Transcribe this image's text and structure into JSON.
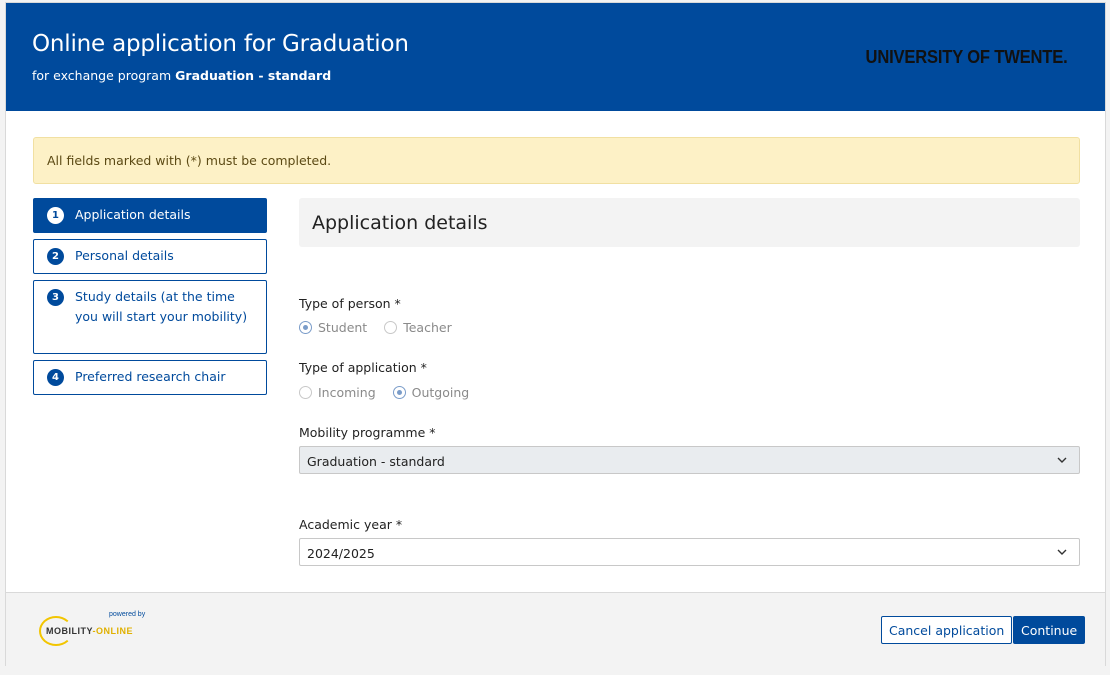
{
  "header": {
    "title": "Online application for Graduation",
    "subtitle_prefix": "for exchange program",
    "subtitle_program": "Graduation - standard",
    "brand": "UNIVERSITY OF TWENTE."
  },
  "notice": "All fields marked with (*) must be completed.",
  "steps": [
    {
      "num": "1",
      "label": "Application details",
      "active": true
    },
    {
      "num": "2",
      "label": "Personal details",
      "active": false
    },
    {
      "num": "3",
      "label": "Study details (at the time you will start your mobility)",
      "active": false
    },
    {
      "num": "4",
      "label": "Preferred research chair",
      "active": false
    }
  ],
  "panel": {
    "heading": "Application details",
    "type_of_person": {
      "label": "Type of person *",
      "options": [
        {
          "label": "Student",
          "checked": true
        },
        {
          "label": "Teacher",
          "checked": false
        }
      ]
    },
    "type_of_application": {
      "label": "Type of application *",
      "options": [
        {
          "label": "Incoming",
          "checked": false
        },
        {
          "label": "Outgoing",
          "checked": true
        }
      ]
    },
    "mobility_programme": {
      "label": "Mobility programme *",
      "value": "Graduation - standard"
    },
    "academic_year": {
      "label": "Academic year *",
      "value": "2024/2025"
    }
  },
  "footer": {
    "logo_powered": "powered by",
    "logo_name_a": "MOBILITY",
    "logo_name_b": "-ONLINE",
    "cancel_label": "Cancel application",
    "continue_label": "Continue"
  },
  "colors": {
    "brand_blue": "#004a9c",
    "notice_bg": "#fdf1c6"
  }
}
